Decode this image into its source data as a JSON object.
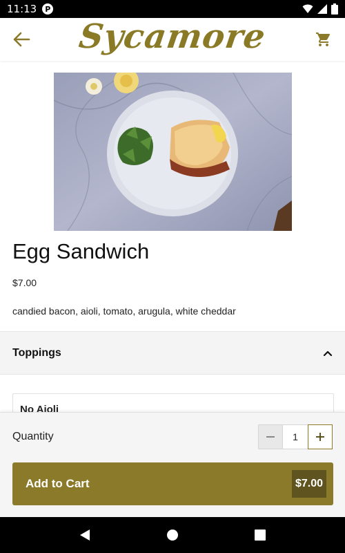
{
  "status_bar": {
    "time": "11:13",
    "app_icon": "P"
  },
  "app_bar": {
    "logo": "Sycamore",
    "icons": [
      "back-arrow-icon",
      "cart-icon"
    ]
  },
  "product": {
    "name": "Egg Sandwich",
    "price": "$7.00",
    "description": "candied bacon, aioli, tomato, arugula, white cheddar"
  },
  "toppings": {
    "title": "Toppings",
    "options": [
      "No Aioli"
    ]
  },
  "bottom": {
    "quantity_label": "Quantity",
    "quantity": "1",
    "add_label": "Add to Cart",
    "total": "$7.00"
  },
  "colors": {
    "brand": "#8a7a2a",
    "brand_dark": "#5f5420"
  }
}
